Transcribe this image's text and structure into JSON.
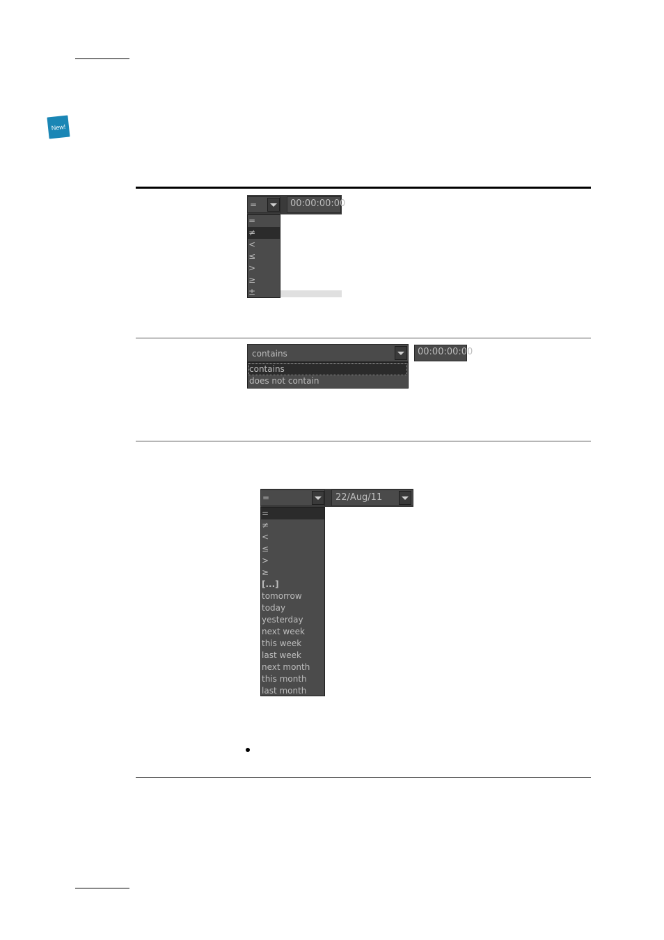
{
  "badge": {
    "label": "New!"
  },
  "row1": {
    "operator_selected": "=",
    "time_value": "00:00:00:00",
    "options": [
      "=",
      "≠",
      "<",
      "≤",
      ">",
      "≥",
      "±"
    ],
    "highlighted_index": 1
  },
  "row2": {
    "operator_selected": "contains",
    "time_value": "00:00:00:00",
    "options": [
      "contains",
      "does not contain"
    ],
    "highlighted_index": 0
  },
  "row3": {
    "operator_selected": "=",
    "date_value": "22/Aug/11",
    "options": [
      "=",
      "≠",
      "<",
      "≤",
      ">",
      "≥",
      "[...]",
      "tomorrow",
      "today",
      "yesterday",
      "next week",
      "this week",
      "last week",
      "next month",
      "this month",
      "last month"
    ],
    "highlighted_index": 0
  },
  "colors": {
    "badge": "#1a86b5",
    "ui_bg": "#4a4a4a",
    "ui_text": "#bdbdbd",
    "ui_selected": "#2b2b2b"
  }
}
